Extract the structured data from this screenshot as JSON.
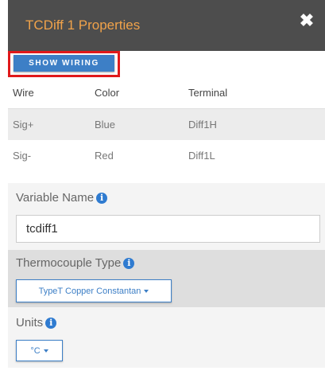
{
  "header": {
    "title": "TCDiff 1 Properties",
    "close_glyph": "✖"
  },
  "wiring_button": {
    "label": "SHOW WIRING"
  },
  "wire_table": {
    "headers": [
      "Wire",
      "Color",
      "Terminal"
    ],
    "rows": [
      [
        "Sig+",
        "Blue",
        "Diff1H"
      ],
      [
        "Sig-",
        "Red",
        "Diff1L"
      ]
    ]
  },
  "variable_name": {
    "label": "Variable Name",
    "value": "tcdiff1"
  },
  "thermocouple_type": {
    "label": "Thermocouple Type",
    "selected": "TypeT Copper Constantan"
  },
  "units": {
    "label": "Units",
    "selected": "°C"
  },
  "info_glyph": "i",
  "colors": {
    "header_bg": "#4d4d4d",
    "title_text": "#f0a24a",
    "accent_blue": "#3d7fc6",
    "highlight_red": "#e0191b"
  }
}
